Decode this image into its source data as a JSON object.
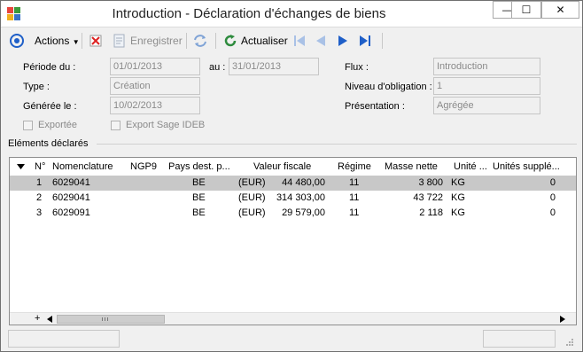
{
  "window": {
    "title": "Introduction -  Déclaration d'échanges de biens",
    "minimize_glyph": "—",
    "maximize_glyph": "☐",
    "close_glyph": "✕"
  },
  "toolbar": {
    "actions_label": "Actions",
    "save_label": "Enregistrer",
    "refresh_label": "Actualiser"
  },
  "form": {
    "periode_label": "Période du :",
    "periode_from": "01/01/2013",
    "au_label": "au :",
    "periode_to": "31/01/2013",
    "type_label": "Type :",
    "type_value": "Création",
    "generee_label": "Générée le :",
    "generee_value": "10/02/2013",
    "exportee_label": "Exportée",
    "export_sage_label": "Export Sage IDEB",
    "flux_label": "Flux :",
    "flux_value": "Introduction",
    "niveau_label": "Niveau d'obligation :",
    "niveau_value": "1",
    "presentation_label": "Présentation :",
    "presentation_value": "Agrégée"
  },
  "section": {
    "elements_label": "Eléments déclarés"
  },
  "grid": {
    "columns": [
      "N°",
      "Nomenclature",
      "NGP9",
      "Pays dest. p...",
      "Valeur fiscale",
      "Régime",
      "Masse nette",
      "Unité ...",
      "Unités supplé..."
    ],
    "rows": [
      {
        "n": "1",
        "nomenclature": "6029041",
        "ngp9": "",
        "pays": "BE",
        "devise": "(EUR)",
        "valeur": "44 480,00",
        "regime": "11",
        "masse": "3 800",
        "unite": "KG",
        "unites_supp": "0"
      },
      {
        "n": "2",
        "nomenclature": "6029041",
        "ngp9": "",
        "pays": "BE",
        "devise": "(EUR)",
        "valeur": "314 303,00",
        "regime": "11",
        "masse": "43 722",
        "unite": "KG",
        "unites_supp": "0"
      },
      {
        "n": "3",
        "nomenclature": "6029091",
        "ngp9": "",
        "pays": "BE",
        "devise": "(EUR)",
        "valeur": "29 579,00",
        "regime": "11",
        "masse": "2 118",
        "unite": "KG",
        "unites_supp": "0"
      }
    ],
    "add_glyph": "+"
  },
  "colors": {
    "nav_blue": "#1f5fc8",
    "selected_row": "#c8c8c8"
  }
}
